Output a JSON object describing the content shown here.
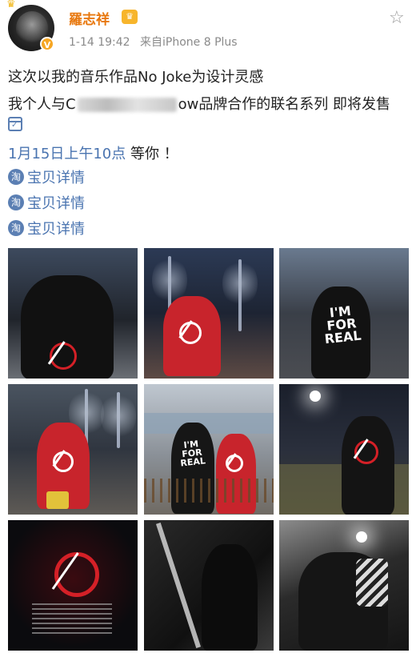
{
  "post": {
    "username": "羅志祥",
    "timestamp": "1-14 19:42",
    "source": "来自iPhone 8 Plus",
    "line1": "这次以我的音乐作品No Joke为设计灵感",
    "line2_prefix": "我个人与C",
    "line2_suffix": "ow品牌合作的联名系列 即将发售",
    "date_text": "1月15日上午10点",
    "date_suffix": " 等你 ！",
    "links": [
      "宝贝详情",
      "宝贝详情",
      "宝贝详情"
    ],
    "shirt_text_a": "I'M\nFOR\nREAL",
    "shirt_text_b": "I'M\nFOR\nREAL"
  },
  "icons": {
    "favorite": "star-outline-icon",
    "verified": "verified-badge-icon",
    "vip": "crown-icon",
    "calendar": "calendar-icon",
    "taobao": "taobao-icon"
  },
  "colors": {
    "username": "#e8780e",
    "link": "#4a74b0",
    "meta": "#8a8a8a"
  }
}
